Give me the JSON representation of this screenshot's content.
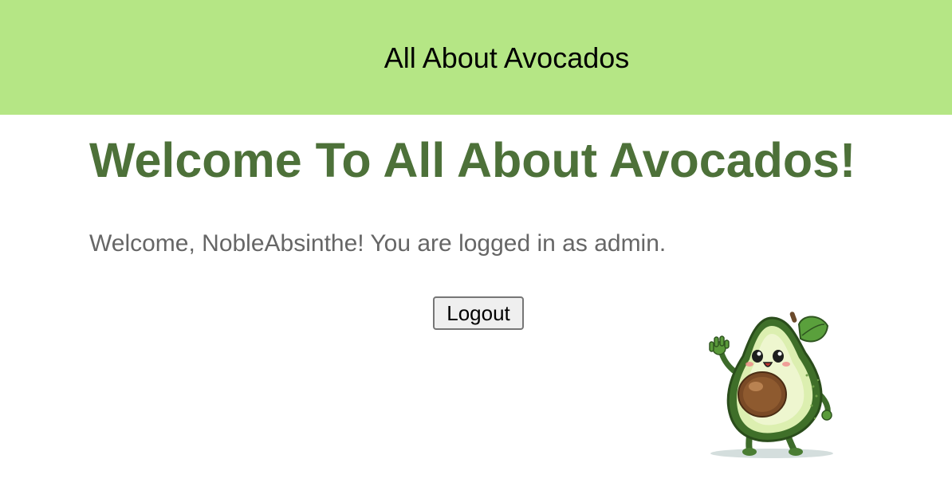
{
  "header": {
    "site_title": "All About Avocados",
    "background_color": "#b5e685"
  },
  "main": {
    "heading": "Welcome To All About Avocados!",
    "heading_color": "#4d7139",
    "welcome_message": "Welcome, NobleAbsinthe! You are logged in as admin.",
    "logout_label": "Logout"
  },
  "mascot": {
    "icon": "avocado-mascot-waving"
  }
}
